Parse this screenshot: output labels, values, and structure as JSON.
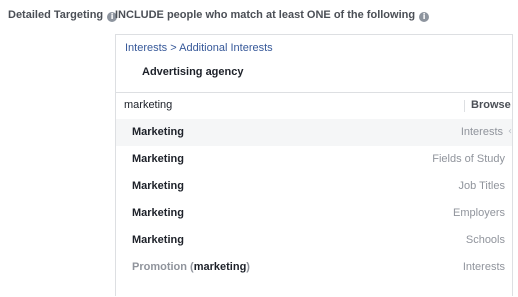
{
  "header": {
    "label": "Detailed Targeting",
    "include_text": "INCLUDE people who match at least ONE of the following"
  },
  "icons": {
    "info": "info-icon",
    "chevron": "chevron-left-icon"
  },
  "panel": {
    "breadcrumb": "Interests > Additional Interests",
    "selected": "Advertising agency"
  },
  "search": {
    "value": "marketing",
    "browse_label": "Browse"
  },
  "results": [
    {
      "name": "Marketing",
      "type": "Interests",
      "highlighted": true
    },
    {
      "name": "Marketing",
      "type": "Fields of Study"
    },
    {
      "name": "Marketing",
      "type": "Job Titles"
    },
    {
      "name": "Marketing",
      "type": "Employers"
    },
    {
      "name": "Marketing",
      "type": "Schools"
    },
    {
      "name_prefix": "Promotion (",
      "name_term": "marketing",
      "name_suffix": ")",
      "type": "Interests",
      "muted": true
    }
  ],
  "colors": {
    "link": "#365899",
    "muted": "#90949c",
    "border": "#dddfe2",
    "highlight": "#f5f6f7"
  }
}
